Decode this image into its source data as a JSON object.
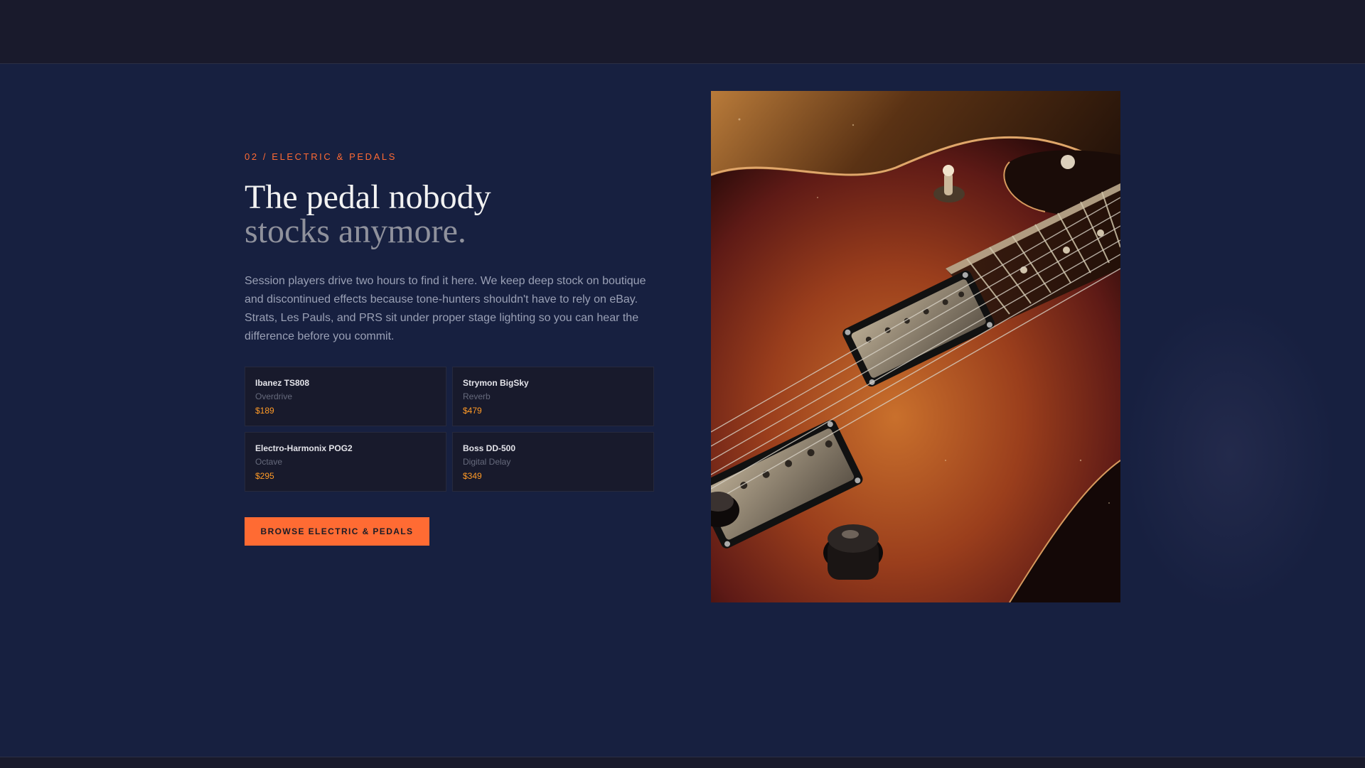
{
  "section": {
    "eyebrow": "02 / ELECTRIC & PEDALS",
    "headline_line1": "The pedal nobody",
    "headline_line2": "stocks anymore.",
    "body": "Session players drive two hours to find it here. We keep deep stock on boutique and discontinued effects because tone-hunters shouldn't have to rely on eBay. Strats, Les Pauls, and PRS sit under proper stage lighting so you can hear the difference before you commit.",
    "products": [
      {
        "name": "Ibanez TS808",
        "category": "Overdrive",
        "price": "$189"
      },
      {
        "name": "Strymon BigSky",
        "category": "Reverb",
        "price": "$479"
      },
      {
        "name": "Electro-Harmonix POG2",
        "category": "Octave",
        "price": "$295"
      },
      {
        "name": "Boss DD-500",
        "category": "Digital Delay",
        "price": "$349"
      }
    ],
    "cta_label": "BROWSE ELECTRIC & PEDALS"
  },
  "colors": {
    "accent": "#ff6b33",
    "price": "#ff9a26",
    "background": "#172040",
    "card": "#181a2c"
  },
  "image": {
    "subject": "sunburst-electric-guitar-photo"
  }
}
